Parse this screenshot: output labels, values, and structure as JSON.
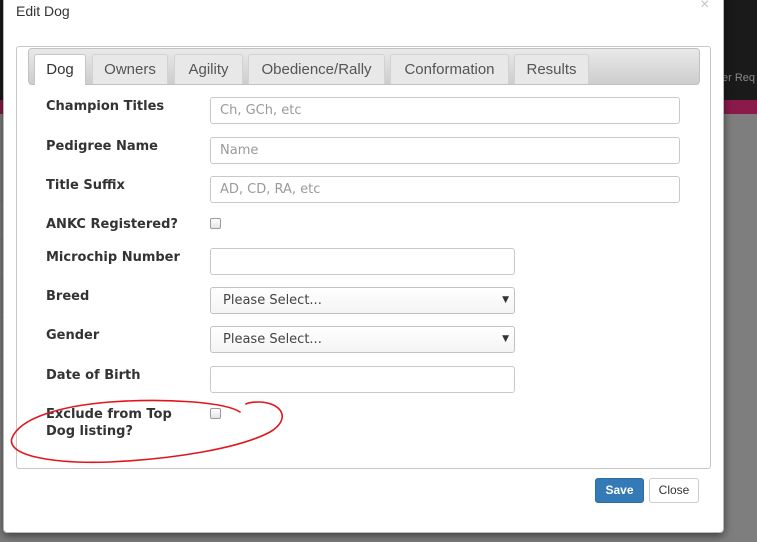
{
  "modal": {
    "title": "Edit Dog",
    "close_glyph": "×"
  },
  "background": {
    "right_text": "er Req"
  },
  "tabs": [
    {
      "label": "Dog",
      "active": true
    },
    {
      "label": "Owners",
      "active": false
    },
    {
      "label": "Agility",
      "active": false
    },
    {
      "label": "Obedience/Rally",
      "active": false
    },
    {
      "label": "Conformation",
      "active": false
    },
    {
      "label": "Results",
      "active": false
    }
  ],
  "form": {
    "champion_titles": {
      "label": "Champion Titles",
      "placeholder": "Ch, GCh, etc",
      "value": ""
    },
    "pedigree_name": {
      "label": "Pedigree Name",
      "placeholder": "Name",
      "value": ""
    },
    "title_suffix": {
      "label": "Title Suffix",
      "placeholder": "AD, CD, RA, etc",
      "value": ""
    },
    "ankc_registered": {
      "label": "ANKC Registered?",
      "checked": false
    },
    "microchip_number": {
      "label": "Microchip Number",
      "value": ""
    },
    "breed": {
      "label": "Breed",
      "selected": "Please Select..."
    },
    "gender": {
      "label": "Gender",
      "selected": "Please Select..."
    },
    "date_of_birth": {
      "label": "Date of Birth",
      "value": ""
    },
    "exclude_top_dog": {
      "label_line1": "Exclude from Top",
      "label_line2": "Dog listing?",
      "checked": false
    }
  },
  "buttons": {
    "save": "Save",
    "close": "Close"
  },
  "colors": {
    "primary_button": "#337ab7",
    "annotation": "#e0161c",
    "accent_bar": "#8b1a4a"
  },
  "icons": {
    "select_caret": "▼"
  }
}
